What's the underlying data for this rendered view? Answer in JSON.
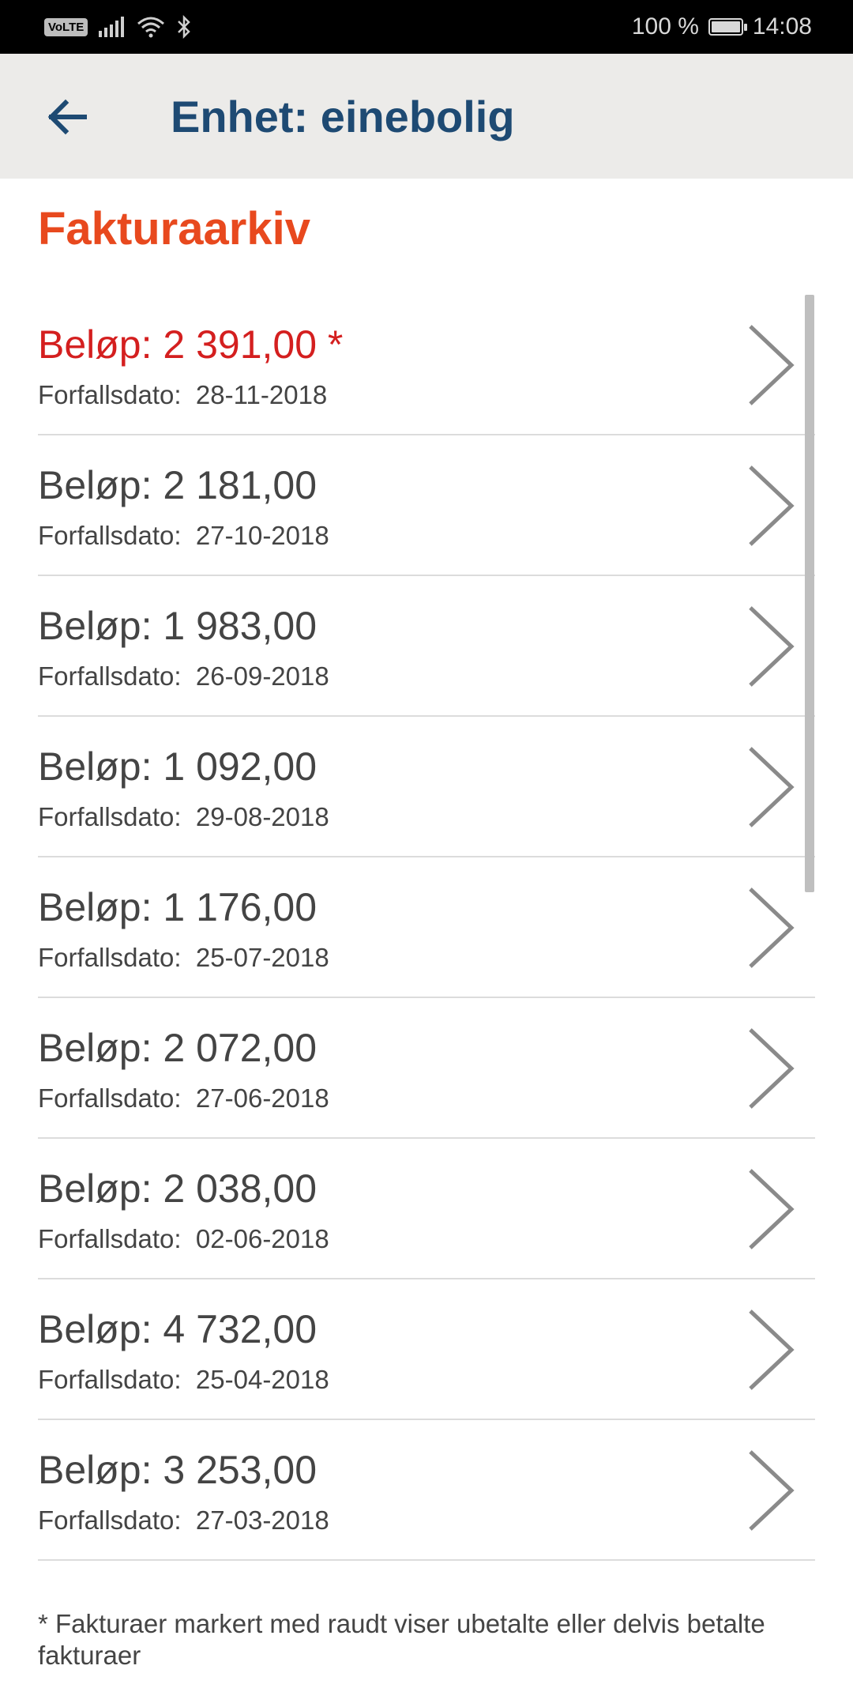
{
  "status_bar": {
    "volte": "VoLTE",
    "battery_percent": "100 %",
    "time": "14:08",
    "icons": [
      "signal-icon",
      "wifi-icon",
      "bluetooth-icon",
      "battery-charging-icon"
    ]
  },
  "app_bar": {
    "title": "Enhet: einebolig",
    "back_icon": "arrow-left-icon"
  },
  "section_title": "Fakturaarkiv",
  "invoices": [
    {
      "amount": "Beløp: 2 391,00 *",
      "due": "Forfallsdato:  28-11-2018",
      "unpaid": true
    },
    {
      "amount": "Beløp: 2 181,00",
      "due": "Forfallsdato:  27-10-2018",
      "unpaid": false
    },
    {
      "amount": "Beløp: 1 983,00",
      "due": "Forfallsdato:  26-09-2018",
      "unpaid": false
    },
    {
      "amount": "Beløp: 1 092,00",
      "due": "Forfallsdato:  29-08-2018",
      "unpaid": false
    },
    {
      "amount": "Beløp: 1 176,00",
      "due": "Forfallsdato:  25-07-2018",
      "unpaid": false
    },
    {
      "amount": "Beløp: 2 072,00",
      "due": "Forfallsdato:  27-06-2018",
      "unpaid": false
    },
    {
      "amount": "Beløp: 2 038,00",
      "due": "Forfallsdato:  02-06-2018",
      "unpaid": false
    },
    {
      "amount": "Beløp: 4 732,00",
      "due": "Forfallsdato:  25-04-2018",
      "unpaid": false
    },
    {
      "amount": "Beløp: 3 253,00",
      "due": "Forfallsdato:  27-03-2018",
      "unpaid": false
    }
  ],
  "footnote": "* Fakturaer markert med raudt viser ubetalte eller delvis betalte fakturaer",
  "colors": {
    "accent": "#e8491e",
    "title": "#1e4a73",
    "unpaid": "#d41f1f",
    "text": "#444444",
    "appbar_bg": "#ecebe9"
  }
}
